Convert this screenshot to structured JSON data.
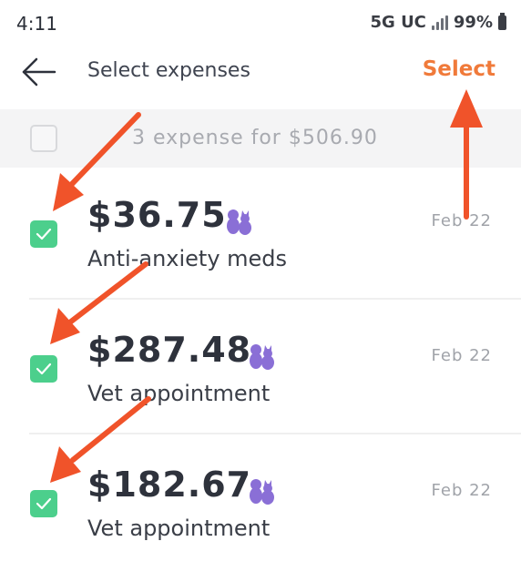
{
  "status_bar": {
    "time": "4:11",
    "network": "5G UC",
    "battery": "99%"
  },
  "header": {
    "title": "Select expenses",
    "select_label": "Select"
  },
  "summary": {
    "text": "3 expense for $506.90",
    "checked": false
  },
  "expenses": [
    {
      "amount": "$36.75",
      "description": "Anti-anxiety meds",
      "date": "Feb 22",
      "checked": true,
      "icon": "pets-icon"
    },
    {
      "amount": "$287.48",
      "description": "Vet appointment",
      "date": "Feb 22",
      "checked": true,
      "icon": "pets-icon"
    },
    {
      "amount": "$182.67",
      "description": "Vet appointment",
      "date": "Feb 22",
      "checked": true,
      "icon": "pets-icon"
    }
  ],
  "colors": {
    "accent": "#f07a3a",
    "checkbox": "#4ccf8c",
    "pet_icon": "#8a6fd6",
    "annotation_arrow": "#f0532a"
  }
}
